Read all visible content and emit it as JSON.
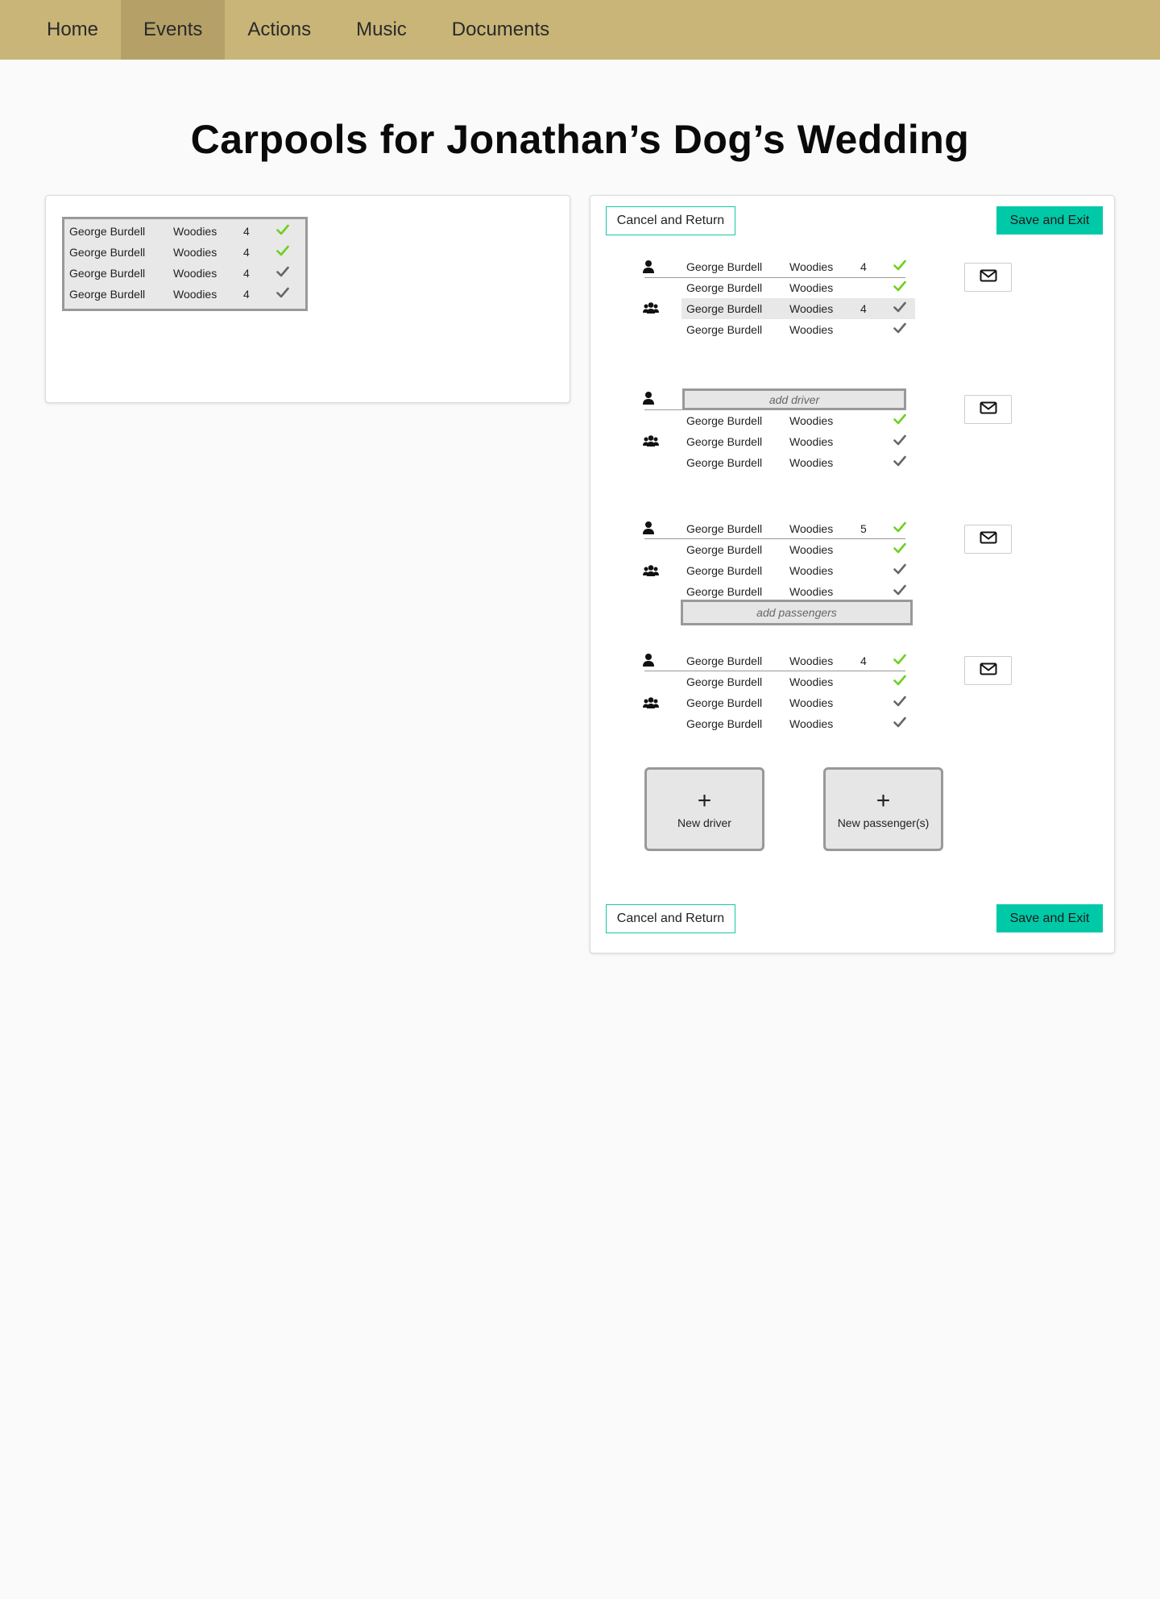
{
  "nav": {
    "items": [
      {
        "label": "Home"
      },
      {
        "label": "Events"
      },
      {
        "label": "Actions"
      },
      {
        "label": "Music"
      },
      {
        "label": "Documents"
      }
    ],
    "active": "Events"
  },
  "page": {
    "title": "Carpools for Jonathan’s Dog’s Wedding"
  },
  "colors": {
    "nav_bg": "#c8b577",
    "nav_active": "#b5a168",
    "accent": "#00c9a7",
    "check_confirmed": "#6fcf1f",
    "check_pending": "#666666"
  },
  "pool": {
    "rows": [
      {
        "name": "George Burdell",
        "car": "Woodies",
        "seats": "4",
        "status": "confirmed"
      },
      {
        "name": "George Burdell",
        "car": "Woodies",
        "seats": "4",
        "status": "confirmed"
      },
      {
        "name": "George Burdell",
        "car": "Woodies",
        "seats": "4",
        "status": "pending"
      },
      {
        "name": "George Burdell",
        "car": "Woodies",
        "seats": "4",
        "status": "pending"
      }
    ]
  },
  "actions": {
    "cancel_label": "Cancel and Return",
    "save_label": "Save and Exit"
  },
  "carpools": [
    {
      "driver": {
        "name": "George Burdell",
        "car": "Woodies",
        "seats": "4",
        "status": "confirmed"
      },
      "passengers": [
        {
          "name": "George Burdell",
          "car": "Woodies",
          "status": "confirmed"
        },
        {
          "name": "George Burdell",
          "car": "Woodies",
          "seats": "4",
          "status": "pending",
          "highlighted": true
        },
        {
          "name": "George Burdell",
          "car": "Woodies",
          "status": "pending"
        }
      ]
    },
    {
      "driver_placeholder": "add driver",
      "passengers": [
        {
          "name": "George Burdell",
          "car": "Woodies",
          "status": "confirmed"
        },
        {
          "name": "George Burdell",
          "car": "Woodies",
          "status": "pending"
        },
        {
          "name": "George Burdell",
          "car": "Woodies",
          "status": "pending"
        }
      ]
    },
    {
      "driver": {
        "name": "George Burdell",
        "car": "Woodies",
        "seats": "5",
        "status": "confirmed"
      },
      "passengers": [
        {
          "name": "George Burdell",
          "car": "Woodies",
          "status": "confirmed"
        },
        {
          "name": "George Burdell",
          "car": "Woodies",
          "status": "pending"
        },
        {
          "name": "George Burdell",
          "car": "Woodies",
          "status": "pending"
        }
      ],
      "passenger_placeholder": "add passengers"
    },
    {
      "driver": {
        "name": "George Burdell",
        "car": "Woodies",
        "seats": "4",
        "status": "confirmed"
      },
      "passengers": [
        {
          "name": "George Burdell",
          "car": "Woodies",
          "status": "confirmed"
        },
        {
          "name": "George Burdell",
          "car": "Woodies",
          "status": "pending"
        },
        {
          "name": "George Burdell",
          "car": "Woodies",
          "status": "pending"
        }
      ]
    }
  ],
  "new_buttons": {
    "plus": "+",
    "driver_label": "New driver",
    "passenger_label": "New passenger(s)"
  },
  "icons": {
    "driver": "person-icon",
    "passengers": "group-icon",
    "mail": "envelope-icon",
    "check": "checkmark-icon"
  }
}
